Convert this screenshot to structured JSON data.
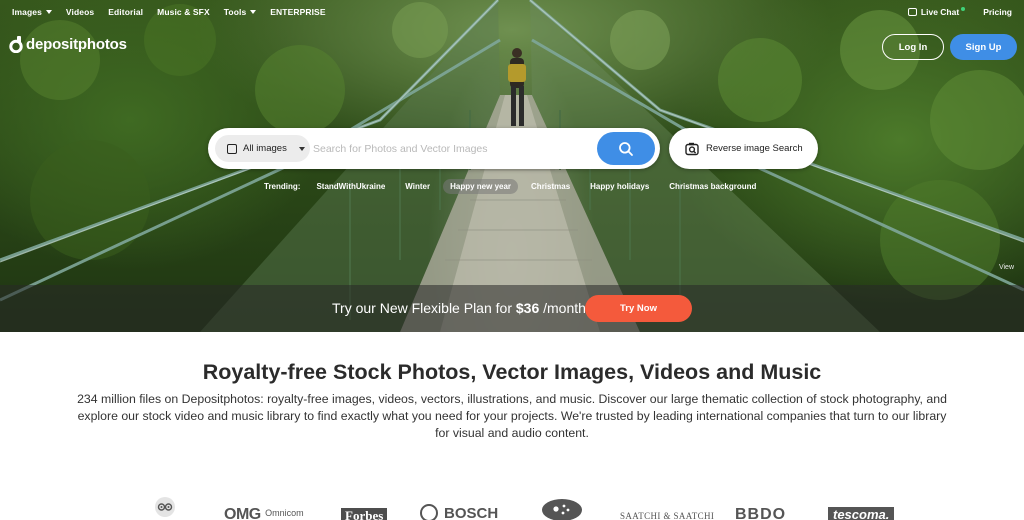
{
  "colors": {
    "primary": "#3f8ee6",
    "accent": "#f45a3c",
    "online": "#3fd37a"
  },
  "nav": {
    "items": [
      {
        "label": "Images",
        "dropdown": true
      },
      {
        "label": "Videos",
        "dropdown": false
      },
      {
        "label": "Editorial",
        "dropdown": false
      },
      {
        "label": "Music & SFX",
        "dropdown": false
      },
      {
        "label": "Tools",
        "dropdown": true
      },
      {
        "label": "ENTERPRISE",
        "dropdown": false
      }
    ],
    "live_chat": "Live Chat",
    "pricing": "Pricing"
  },
  "brand": {
    "name": "depositphotos"
  },
  "auth": {
    "login": "Log In",
    "signup": "Sign Up"
  },
  "search": {
    "category": "All images",
    "placeholder": "Search for Photos and Vector Images",
    "reverse": "Reverse image Search"
  },
  "trending": {
    "label": "Trending:",
    "tags": [
      "StandWithUkraine",
      "Winter",
      "Happy new year",
      "Christmas",
      "Happy holidays",
      "Christmas background"
    ],
    "active_index": 2
  },
  "hero": {
    "view_link": "View"
  },
  "promo": {
    "text_before": "Try our New Flexible Plan for ",
    "price": "$36",
    "text_after": " /month",
    "button": "Try Now"
  },
  "content": {
    "headline": "Royalty-free Stock Photos, Vector Images, Videos and Music",
    "description": "234 million files on Depositphotos: royalty-free images, videos, vectors, illustrations, and music. Discover our large thematic collection of stock photography, and explore our stock video and music library to find exactly what you need for your projects. We're trusted by leading international companies that turn to our library for visual and audio content."
  },
  "client_logos": [
    "tripadvisor",
    "Omnicom",
    "Forbes",
    "BOSCH",
    "Subaru",
    "SAATCHI & SAATCHI",
    "BBDO",
    "tescoma."
  ]
}
